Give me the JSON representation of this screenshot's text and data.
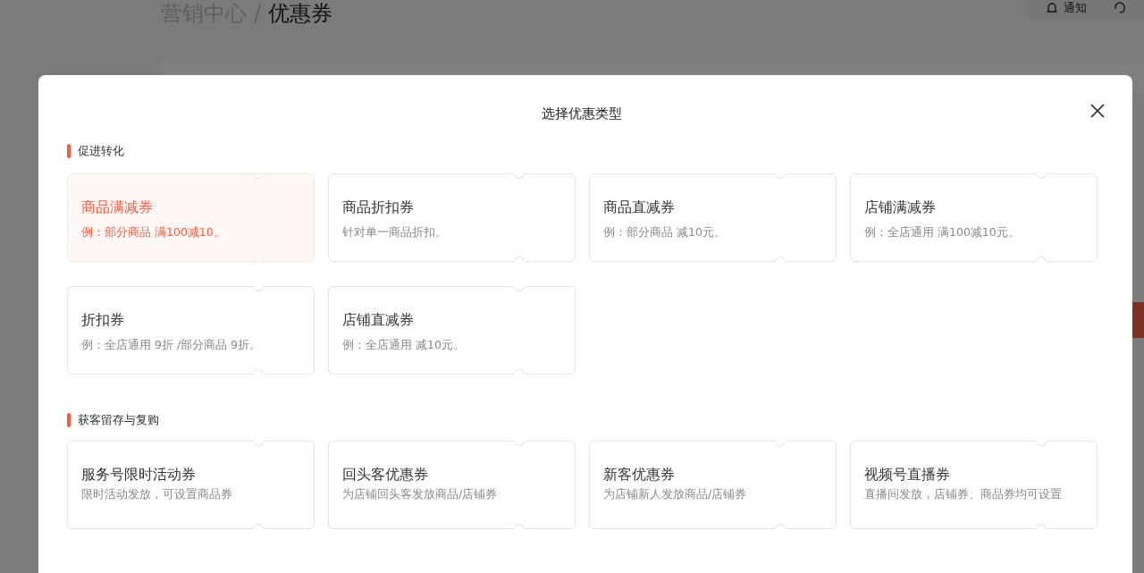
{
  "breadcrumb": {
    "parent": "营销中心",
    "separator": "/",
    "current": "优惠券"
  },
  "header": {
    "notice": "通知"
  },
  "dialog": {
    "title": "选择优惠类型",
    "sections": [
      {
        "title": "促进转化",
        "cards": [
          {
            "title": "商品满减券",
            "description": "例：部分商品 满100减10。",
            "selected": true
          },
          {
            "title": "商品折扣券",
            "description": "针对单一商品折扣。",
            "selected": false
          },
          {
            "title": "商品直减券",
            "description": "例：部分商品 减10元。",
            "selected": false
          },
          {
            "title": "店铺满减券",
            "description": "例：全店通用 满100减10元。",
            "selected": false
          },
          {
            "title": "折扣券",
            "description": "例：全店通用 9折 /部分商品 9折。",
            "selected": false
          },
          {
            "title": "店铺直减券",
            "description": "例：全店通用 减10元。",
            "selected": false
          }
        ]
      },
      {
        "title": "获客留存与复购",
        "cards": [
          {
            "title": "服务号限时活动券",
            "description": "限时活动发放，可设置商品券",
            "selected": false
          },
          {
            "title": "回头客优惠券",
            "description": "为店铺回头客发放商品/店铺券",
            "selected": false
          },
          {
            "title": "新客优惠券",
            "description": "为店铺新人发放商品/店铺券",
            "selected": false
          },
          {
            "title": "视频号直播券",
            "description": "直播间发放，店铺券、商品券均可设置",
            "selected": false
          }
        ]
      }
    ]
  }
}
